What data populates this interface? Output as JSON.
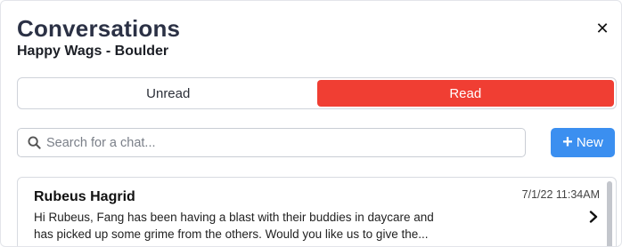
{
  "header": {
    "title": "Conversations",
    "subtitle": "Happy Wags - Boulder",
    "close_icon": "close-icon"
  },
  "tabs": {
    "unread": "Unread",
    "read": "Read",
    "active": "Read",
    "active_color": "#f03e33"
  },
  "search": {
    "placeholder": "Search for a chat...",
    "value": ""
  },
  "new_button": {
    "label": "New",
    "color": "#3b8ff0"
  },
  "conversations": [
    {
      "name": "Rubeus Hagrid",
      "timestamp": "7/1/22 11:34AM",
      "preview_line1": "Hi Rubeus, Fang has been having a blast with their buddies in daycare and",
      "preview_line2": "has picked up some grime from the others. Would you like us to give the..."
    }
  ]
}
